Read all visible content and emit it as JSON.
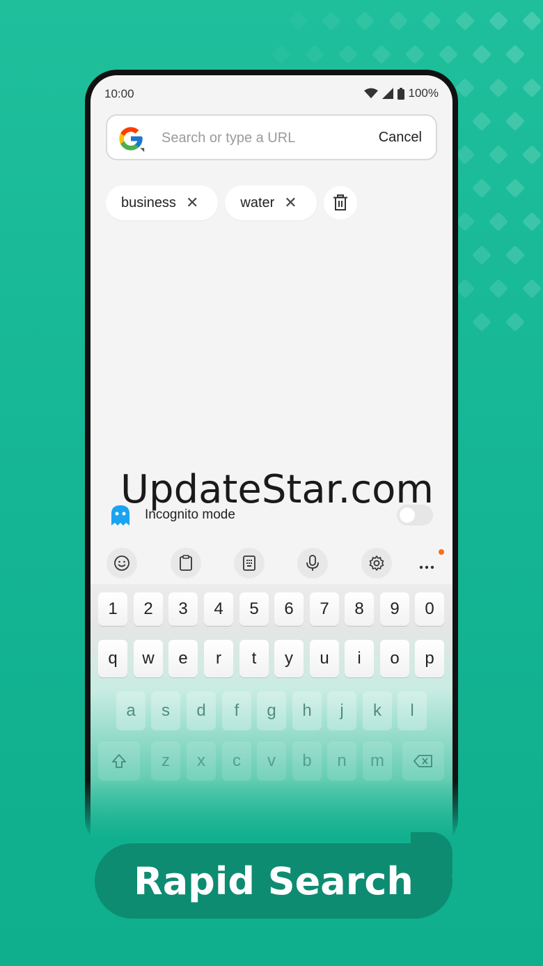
{
  "status_bar": {
    "time": "10:00",
    "battery": "100%"
  },
  "search": {
    "placeholder": "Search or type a URL",
    "cancel_label": "Cancel"
  },
  "chips": [
    {
      "label": "business",
      "close": "✕"
    },
    {
      "label": "water",
      "close": "✕"
    }
  ],
  "incognito": {
    "label": "Incognito mode",
    "enabled": false
  },
  "keyboard": {
    "row_numbers": [
      "1",
      "2",
      "3",
      "4",
      "5",
      "6",
      "7",
      "8",
      "9",
      "0"
    ],
    "row_top": [
      "q",
      "w",
      "e",
      "r",
      "t",
      "y",
      "u",
      "i",
      "o",
      "p"
    ],
    "row_middle": [
      "a",
      "s",
      "d",
      "f",
      "g",
      "h",
      "j",
      "k",
      "l"
    ],
    "row_bottom": [
      "z",
      "x",
      "c",
      "v",
      "b",
      "n",
      "m"
    ]
  },
  "toolbar_icons": [
    "emoji-icon",
    "clipboard-icon",
    "keypad-icon",
    "microphone-icon",
    "settings-icon",
    "more-icon"
  ],
  "watermark": "UpdateStar.com",
  "cta_label": "Rapid Search",
  "colors": {
    "background": "#14b594",
    "cta": "#0d8c72",
    "badge": "#ff6d1a"
  }
}
